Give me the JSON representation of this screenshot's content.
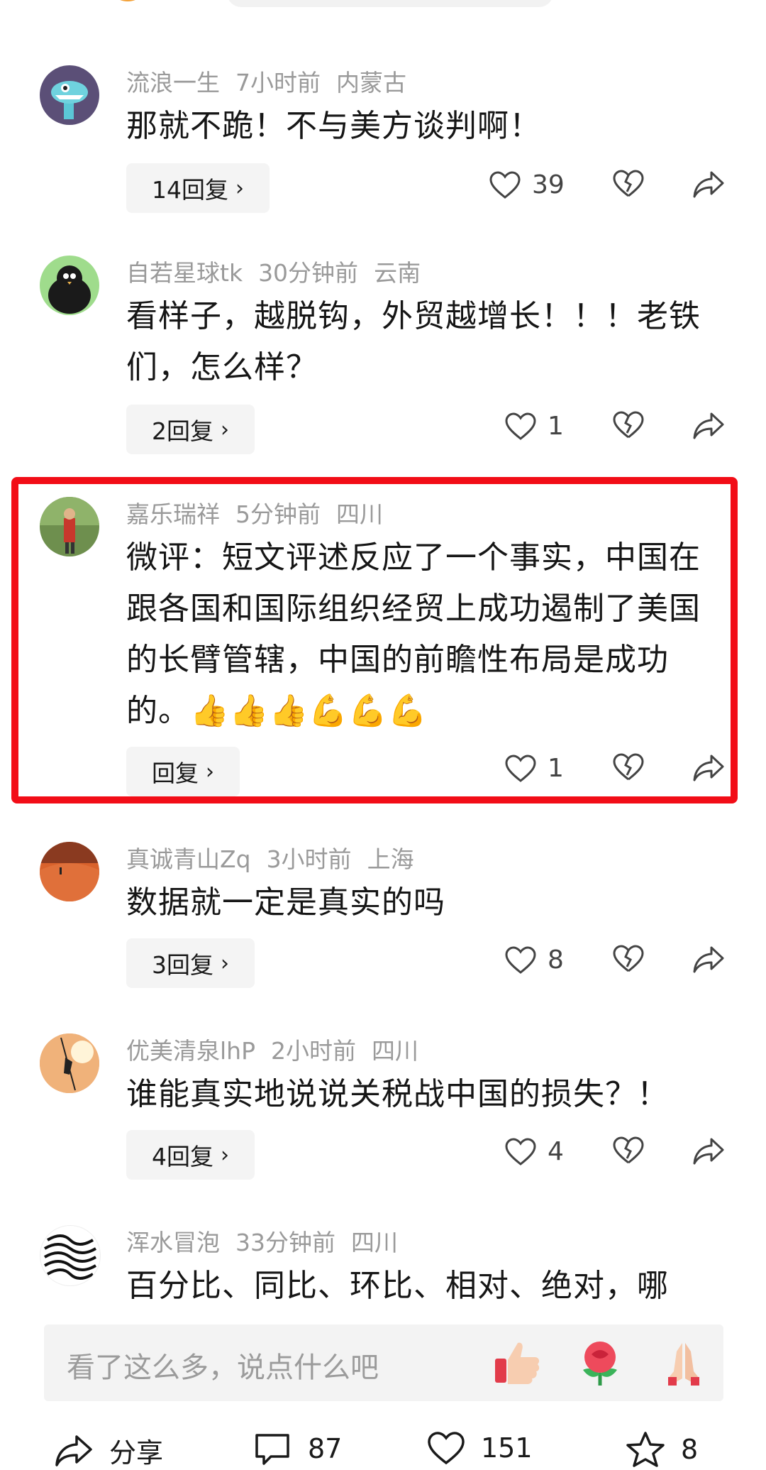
{
  "comments": [
    {
      "user": "流浪一生",
      "time": "7小时前",
      "location": "内蒙古",
      "text": "那就不跪！不与美方谈判啊！",
      "reply_label": "14回复",
      "likes": "39"
    },
    {
      "user": "自若星球tk",
      "time": "30分钟前",
      "location": "云南",
      "text": "看样子，越脱钩，外贸越增长！！！老铁们，怎么样？",
      "reply_label": "2回复",
      "likes": "1"
    },
    {
      "user": "嘉乐瑞祥",
      "time": "5分钟前",
      "location": "四川",
      "text": "微评：短文评述反应了一个事实，中国在跟各国和国际组织经贸上成功遏制了美国的长臂管辖，中国的前瞻性布局是成功的。",
      "reply_label": "回复",
      "likes": "1"
    },
    {
      "user": "真诚青山Zq",
      "time": "3小时前",
      "location": "上海",
      "text": "数据就一定是真实的吗",
      "reply_label": "3回复",
      "likes": "8"
    },
    {
      "user": "优美清泉lhP",
      "time": "2小时前",
      "location": "四川",
      "text": "谁能真实地说说关税战中国的损失？！",
      "reply_label": "4回复",
      "likes": "4"
    },
    {
      "user": "浑水冒泡",
      "time": "33分钟前",
      "location": "四川",
      "text": "百分比、同比、环比、相对、绝对，哪"
    }
  ],
  "input": {
    "placeholder": "看了这么多，说点什么吧"
  },
  "bottom_bar": {
    "share_label": "分享",
    "comment_count": "87",
    "like_count": "151",
    "favorite_count": "8"
  },
  "colors": {
    "highlight": "#f20d17",
    "meta": "#9a9a9a",
    "reply_bg": "#f4f4f4"
  }
}
